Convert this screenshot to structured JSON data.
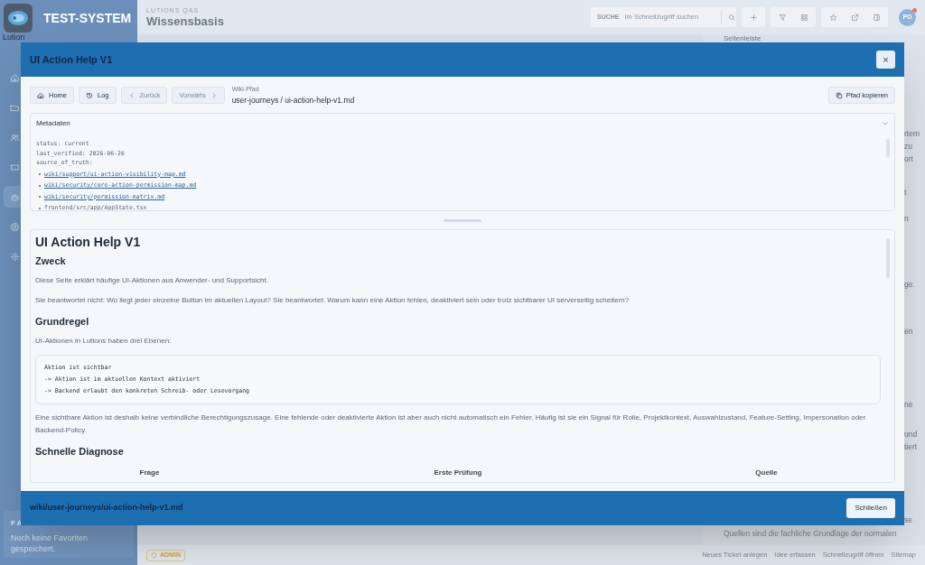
{
  "app": {
    "logo_title": "TEST-SYSTEM",
    "sidebar_caption": "Lution",
    "nav": [
      {
        "selected": false
      },
      {
        "selected": false
      },
      {
        "selected": false
      },
      {
        "selected": false
      },
      {
        "selected": true
      },
      {
        "selected": false
      },
      {
        "selected": false
      }
    ],
    "favorites": {
      "heading": "FA",
      "empty_text": "Noch keine Favoriten gespeichert."
    },
    "header": {
      "eyebrow": "LUTIONS QAS",
      "title": "Wissensbasis",
      "search_label": "SUCHE",
      "search_placeholder": "Im Schnellzugriff suchen",
      "avatar": "PO",
      "notification": true
    },
    "side_panel": {
      "title": "Seitenleiste",
      "fragments": [
        "rtem",
        "zu",
        "ort",
        "t",
        "n",
        "ge.",
        "en",
        "ne",
        "und",
        "tiert",
        "se"
      ],
      "lines": [
        "Quellen sind die fachliche Grundlage der normalen"
      ]
    },
    "footer": {
      "badge": "ADMIN",
      "links": [
        "Neues Ticket anlegen",
        "Idee erfassen",
        "Schnellzugriff öffnen",
        "Sitemap"
      ]
    }
  },
  "modal": {
    "title": "UI Action Help V1",
    "close": "×",
    "toolbar": [
      {
        "kind": "home",
        "label": "Home",
        "disabled": false
      },
      {
        "kind": "log",
        "label": "Log",
        "disabled": false
      },
      {
        "kind": "back",
        "label": "Zurück",
        "disabled": true
      },
      {
        "kind": "forward",
        "label": "Vorwärts",
        "disabled": true
      }
    ],
    "path_label": "Wiki-Pfad",
    "path": "user-journeys / ui-action-help-v1.md",
    "copy_button": "Pfad kopieren",
    "metadata": {
      "title": "Metadaten",
      "expanded": true,
      "lines": [
        "status: current",
        "last_verified: 2026-06-26",
        "source_of_truth:"
      ],
      "items": [
        {
          "text": "wiki/support/ui-action-visibility-map.md",
          "link": true
        },
        {
          "text": "wiki/security/core-action-permission-map.md",
          "link": true
        },
        {
          "text": "wiki/security/permission-matrix.md",
          "link": true
        },
        {
          "text": "frontend/src/app/AppState.tsx",
          "link": false
        }
      ]
    },
    "content": [
      {
        "kind": "h1",
        "text": "UI Action Help V1"
      },
      {
        "kind": "h2",
        "text": "Zweck"
      },
      {
        "kind": "p",
        "text": "Diese Seite erklärt häufige UI-Aktionen aus Anwender- und Supportsicht."
      },
      {
        "kind": "p",
        "text": "Sie beantwortet nicht: Wo liegt jeder einzelne Button im aktuellen Layout? Sie beantwortet: Warum kann eine Aktion fehlen, deaktiviert sein oder trotz sichtbarer UI serverseitig scheitern?"
      },
      {
        "kind": "h2",
        "text": "Grundregel"
      },
      {
        "kind": "p",
        "text": "UI-Aktionen in Lutions haben drei Ebenen:"
      },
      {
        "kind": "code",
        "lines": [
          "Aktion ist sichtbar",
          "-> Aktion ist im aktuellen Kontext aktiviert",
          "-> Backend erlaubt den konkreten Schreib- oder Lesevorgang"
        ]
      },
      {
        "kind": "p",
        "text": "Eine sichtbare Aktion ist deshalb keine verbindliche Berechtigungszusage. Eine fehlende oder deaktivierte Aktion ist aber auch nicht automatisch ein Fehler. Häufig ist sie ein Signal für Rolle, Projektkontext, Auswahlzustand, Feature-Setting, Impersonation oder Backend-Policy."
      },
      {
        "kind": "h2",
        "text": "Schnelle Diagnose"
      },
      {
        "kind": "table_header",
        "columns": [
          "Frage",
          "Erste Prüfung",
          "Quelle"
        ]
      }
    ],
    "footer_path": "wiki/user-journeys/ui-action-help-v1.md",
    "footer_button": "Schließen"
  }
}
